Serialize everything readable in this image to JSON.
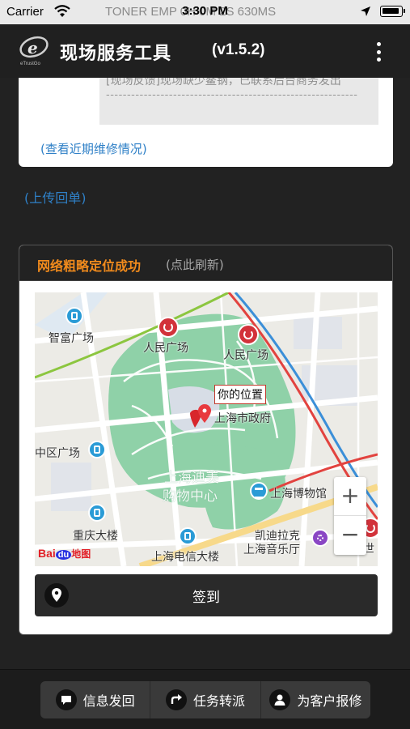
{
  "status_bar": {
    "carrier": "Carrier",
    "time": "3:30 PM",
    "ghost_text": "TONER EMP   0H 0M 2S 630MS"
  },
  "header": {
    "title": "现场服务工具",
    "version": "(v1.5.2)",
    "logo_text": "eTrustGo"
  },
  "upper_card": {
    "report_text": "[现场反馈]现场缺少鳌钢，已联系后台商务发出",
    "divider": "------------------------------------------------------------",
    "repair_link": "(查看近期维修情况)"
  },
  "upload_link": "(上传回单)",
  "location": {
    "status": "网络粗略定位成功",
    "refresh": "(点此刷新)",
    "checkin_label": "签到"
  },
  "map": {
    "you_are_here": "你的位置",
    "labels": {
      "zhifu": "智富广场",
      "renmin1": "人民广场",
      "renmin2": "人民广场",
      "gov": "上海市政府",
      "zhongqu": "中区广场",
      "diemei": "上海迪美",
      "mall": "购物中心",
      "museum": "上海博物馆",
      "chongqing": "重庆大楼",
      "telecom": "上海电信大楼",
      "kaidi": "凯迪拉克",
      "concert": "上海音乐厅",
      "dashi": "大世"
    },
    "zoom_in": "+",
    "zoom_out": "−",
    "baidu_logo_bai": "Bai",
    "baidu_logo_du": "du",
    "baidu_logo_ditu": "地图",
    "colors": {
      "park": "#8fd1a8",
      "road": "#ffffff",
      "main_road": "#f7d98a",
      "metro_red": "#e2433f",
      "metro_blue": "#3b8fd8",
      "metro_green": "#8cc63f"
    }
  },
  "bottom_bar": {
    "buttons": [
      {
        "label": "信息发回",
        "icon": "chat-bubble-icon"
      },
      {
        "label": "任务转派",
        "icon": "forward-arrow-icon"
      },
      {
        "label": "为客户报修",
        "icon": "user-icon"
      }
    ]
  }
}
